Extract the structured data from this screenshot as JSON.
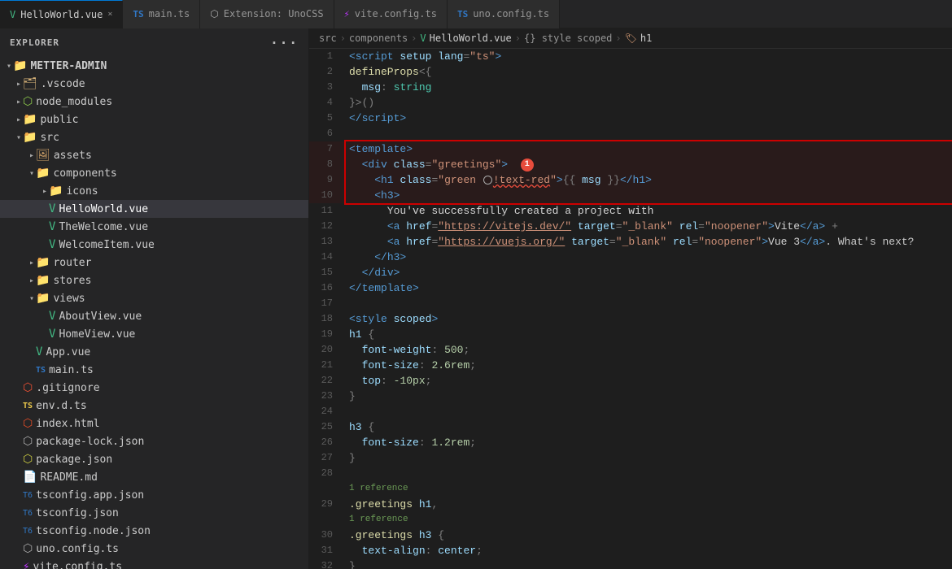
{
  "tabs": [
    {
      "id": "helloworld",
      "label": "HelloWorld.vue",
      "type": "vue",
      "active": true,
      "modified": false
    },
    {
      "id": "main",
      "label": "main.ts",
      "type": "ts",
      "active": false
    },
    {
      "id": "extension",
      "label": "Extension: UnoCSS",
      "type": "ext",
      "active": false
    },
    {
      "id": "viteconfig",
      "label": "vite.config.ts",
      "type": "ts-vite",
      "active": false
    },
    {
      "id": "unoconfig",
      "label": "uno.config.ts",
      "type": "ts",
      "active": false
    }
  ],
  "sidebar": {
    "title": "EXPLORER",
    "root": "METTER-ADMIN",
    "items": [
      {
        "id": "vscode",
        "label": ".vscode",
        "type": "folder",
        "depth": 1,
        "expanded": false
      },
      {
        "id": "node_modules",
        "label": "node_modules",
        "type": "node",
        "depth": 1,
        "expanded": false
      },
      {
        "id": "public",
        "label": "public",
        "type": "folder",
        "depth": 1,
        "expanded": false
      },
      {
        "id": "src",
        "label": "src",
        "type": "folder-src",
        "depth": 1,
        "expanded": true
      },
      {
        "id": "assets",
        "label": "assets",
        "type": "assets",
        "depth": 2,
        "expanded": false
      },
      {
        "id": "components",
        "label": "components",
        "type": "folder",
        "depth": 2,
        "expanded": true
      },
      {
        "id": "icons",
        "label": "icons",
        "type": "folder",
        "depth": 3,
        "expanded": false
      },
      {
        "id": "helloworld",
        "label": "HelloWorld.vue",
        "type": "vue",
        "depth": 3,
        "active": true
      },
      {
        "id": "thewelcome",
        "label": "TheWelcome.vue",
        "type": "vue",
        "depth": 3
      },
      {
        "id": "welcomeitem",
        "label": "WelcomeItem.vue",
        "type": "vue",
        "depth": 3
      },
      {
        "id": "router",
        "label": "router",
        "type": "folder",
        "depth": 2,
        "expanded": false
      },
      {
        "id": "stores",
        "label": "stores",
        "type": "folder",
        "depth": 2,
        "expanded": false
      },
      {
        "id": "views",
        "label": "views",
        "type": "folder",
        "depth": 2,
        "expanded": true
      },
      {
        "id": "aboutview",
        "label": "AboutView.vue",
        "type": "vue",
        "depth": 3
      },
      {
        "id": "homeview",
        "label": "HomeView.vue",
        "type": "vue",
        "depth": 3
      },
      {
        "id": "appvue",
        "label": "App.vue",
        "type": "vue",
        "depth": 2
      },
      {
        "id": "maints",
        "label": "main.ts",
        "type": "ts",
        "depth": 2
      },
      {
        "id": "gitignore",
        "label": ".gitignore",
        "type": "git",
        "depth": 1
      },
      {
        "id": "envdts",
        "label": "env.d.ts",
        "type": "ts-env",
        "depth": 1
      },
      {
        "id": "indexhtml",
        "label": "index.html",
        "type": "html",
        "depth": 1
      },
      {
        "id": "packagelockjson",
        "label": "package-lock.json",
        "type": "json-lock",
        "depth": 1
      },
      {
        "id": "packagejson",
        "label": "package.json",
        "type": "json",
        "depth": 1
      },
      {
        "id": "readmemd",
        "label": "README.md",
        "type": "md",
        "depth": 1
      },
      {
        "id": "tsconfigappjson",
        "label": "tsconfig.app.json",
        "type": "ts-config",
        "depth": 1
      },
      {
        "id": "tsconfigjson",
        "label": "tsconfig.json",
        "type": "ts-config",
        "depth": 1
      },
      {
        "id": "tsconfignode",
        "label": "tsconfig.node.json",
        "type": "ts-config",
        "depth": 1
      },
      {
        "id": "unoconfig",
        "label": "uno.config.ts",
        "type": "ts-uno",
        "depth": 1
      },
      {
        "id": "viteconfig",
        "label": "vite.config.ts",
        "type": "ts-vite",
        "depth": 1
      }
    ]
  },
  "breadcrumb": [
    {
      "label": "src",
      "type": "text"
    },
    {
      "label": ">",
      "type": "sep"
    },
    {
      "label": "components",
      "type": "text"
    },
    {
      "label": ">",
      "type": "sep"
    },
    {
      "label": "HelloWorld.vue",
      "type": "vue"
    },
    {
      "label": ">",
      "type": "sep"
    },
    {
      "label": "{} style scoped",
      "type": "text"
    },
    {
      "label": ">",
      "type": "sep"
    },
    {
      "label": "h1",
      "type": "tag"
    }
  ],
  "code_lines": [
    {
      "n": 1,
      "html": "<span class='c-tag'>&lt;script</span> <span class='c-attr'>setup</span> <span class='c-attr'>lang</span><span class='c-punct'>=</span><span class='c-str'>\"ts\"</span><span class='c-tag'>&gt;</span>"
    },
    {
      "n": 2,
      "html": "<span class='c-func'>defineProps</span><span class='c-punct'>&lt;{</span>"
    },
    {
      "n": 3,
      "html": "  <span class='c-prop'>msg</span><span class='c-punct'>:</span> <span class='c-type'>string</span>"
    },
    {
      "n": 4,
      "html": "<span class='c-punct'>}&gt;()</span>"
    },
    {
      "n": 5,
      "html": "<span class='c-tag'>&lt;/script&gt;</span>"
    },
    {
      "n": 6,
      "html": ""
    },
    {
      "n": 7,
      "html": "<span class='c-tag'>&lt;template&gt;</span>",
      "highlighted": true
    },
    {
      "n": 8,
      "html": "  <span class='c-tag'>&lt;div</span> <span class='c-attr'>class</span><span class='c-punct'>=</span><span class='c-str'>\"greetings\"</span><span class='c-tag'>&gt;</span><span class='badge-inline'></span>",
      "highlighted": true,
      "badge": true
    },
    {
      "n": 9,
      "html": "    <span class='c-tag'>&lt;h1</span> <span class='c-attr'>class</span><span class='c-punct'>=</span><span class='c-str'>\"green</span> <span class='lightbulb-inline'></span><span class='c-str squiggle'>!text-red</span><span class='c-str'>\"</span><span class='c-tag'>&gt;</span><span class='c-punct'>{{</span> <span class='c-var'>msg</span> <span class='c-punct'>}}</span><span class='c-tag'>&lt;/h1&gt;</span>",
      "highlighted": true
    },
    {
      "n": 10,
      "html": "    <span class='c-tag'>&lt;h3&gt;</span>",
      "highlighted": true
    },
    {
      "n": 11,
      "html": "      You<span class='c-punct'>'</span>ve successfully created a project with"
    },
    {
      "n": 12,
      "html": "      <span class='c-tag'>&lt;a</span> <span class='c-attr'>href</span><span class='c-punct'>=</span><span class='c-str-link'>\"https://vitejs.dev/\"</span> <span class='c-attr'>target</span><span class='c-punct'>=</span><span class='c-str'>\"_blank\"</span> <span class='c-attr'>rel</span><span class='c-punct'>=</span><span class='c-str'>\"noopener\"</span><span class='c-tag'>&gt;</span><span class='c-white'>Vite</span><span class='c-tag'>&lt;/a&gt;</span> <span class='c-punct'>+</span>"
    },
    {
      "n": 13,
      "html": "      <span class='c-tag'>&lt;a</span> <span class='c-attr'>href</span><span class='c-punct'>=</span><span class='c-str-link'>\"https://vuejs.org/\"</span> <span class='c-tag'>&gt;</span><span class='c-attr'>target</span><span class='c-punct'>=</span><span class='c-str'>\"_blank\"</span> <span class='c-attr'>rel</span><span class='c-punct'>=</span><span class='c-str'>\"noopener\"</span><span class='c-tag'>&gt;</span><span class='c-white'>Vue 3</span><span class='c-tag'>&lt;/a&gt;</span>. What's next?"
    },
    {
      "n": 14,
      "html": "    <span class='c-tag'>&lt;/h3&gt;</span>"
    },
    {
      "n": 15,
      "html": "  <span class='c-tag'>&lt;/div&gt;</span>"
    },
    {
      "n": 16,
      "html": "<span class='c-tag'>&lt;/template&gt;</span>"
    },
    {
      "n": 17,
      "html": ""
    },
    {
      "n": 18,
      "html": "<span class='c-tag'>&lt;style</span> <span class='c-attr'>scoped</span><span class='c-tag'>&gt;</span>"
    },
    {
      "n": 19,
      "html": "<span class='c-var'>h1</span> <span class='c-punct'>{</span>"
    },
    {
      "n": 20,
      "html": "  <span class='c-prop'>font-weight</span><span class='c-punct'>:</span> <span class='c-num'>500</span><span class='c-punct'>;</span>"
    },
    {
      "n": 21,
      "html": "  <span class='c-prop'>font-size</span><span class='c-punct'>:</span> <span class='c-num'>2.6rem</span><span class='c-punct'>;</span>"
    },
    {
      "n": 22,
      "html": "  <span class='c-prop'>top</span><span class='c-punct'>:</span> <span class='c-num'>-10px</span><span class='c-punct'>;</span>"
    },
    {
      "n": 23,
      "html": "<span class='c-punct'>}</span>"
    },
    {
      "n": 24,
      "html": ""
    },
    {
      "n": 25,
      "html": "<span class='c-var'>h3</span> <span class='c-punct'>{</span>"
    },
    {
      "n": 26,
      "html": "  <span class='c-prop'>font-size</span><span class='c-punct'>:</span> <span class='c-num'>1.2rem</span><span class='c-punct'>;</span>"
    },
    {
      "n": 27,
      "html": "<span class='c-punct'>}</span>"
    },
    {
      "n": 28,
      "html": ""
    },
    {
      "n": 29,
      "html": "<span class='c-ref'>1 reference</span>",
      "is_ref": true
    },
    {
      "n": "29b",
      "html": "<span class='c-yellow'>.greetings</span> <span class='c-var'>h1</span><span class='c-punct'>,</span>"
    },
    {
      "n": "29c",
      "html": "<span class='c-ref'>1 reference</span>",
      "is_ref": true
    },
    {
      "n": 30,
      "html": "<span class='c-yellow'>.greetings</span> <span class='c-var'>h3</span> <span class='c-punct'>{</span>"
    },
    {
      "n": 31,
      "html": "  <span class='c-prop'>text-align</span><span class='c-punct'>:</span> <span class='c-var'>center</span><span class='c-punct'>;</span>"
    },
    {
      "n": 32,
      "html": "<span class='c-punct'>}</span>"
    }
  ],
  "colors": {
    "active_tab_border": "#0078d4",
    "badge_bg": "#e74c3c",
    "highlight_border": "#cc0000"
  }
}
